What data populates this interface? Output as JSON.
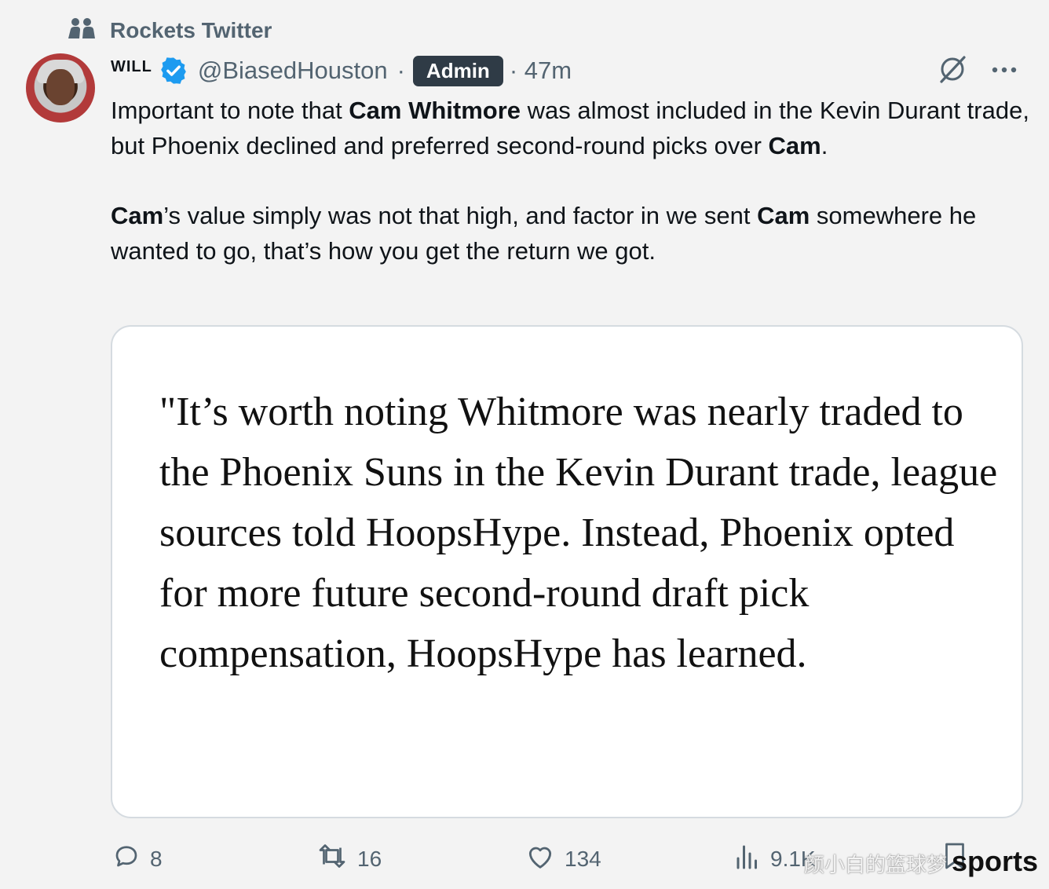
{
  "community": {
    "name": "Rockets Twitter"
  },
  "post": {
    "display_name": "WILL",
    "handle": "@BiasedHouston",
    "separator": "·",
    "badge": "Admin",
    "time": "· 47m",
    "paragraph1": {
      "t1": "Important to note that ",
      "b1": "Cam Whitmore",
      "t2": " was almost included in the Kevin Durant trade, but Phoenix declined and preferred second-round picks over ",
      "b2": "Cam",
      "t3": "."
    },
    "paragraph2": {
      "b1": "Cam",
      "t1": "’s value simply was not that high, and factor in we sent ",
      "b2": "Cam",
      "t2": " somewhere he wanted to go, that’s how you get the return we got."
    },
    "quote": "\"It’s worth noting Whitmore was nearly traded to the Phoenix Suns in the Kevin Durant trade, league sources told HoopsHype. Instead, Phoenix opted for more future second-round draft pick compensation, HoopsHype has learned."
  },
  "actions": {
    "replies": "8",
    "reposts": "16",
    "likes": "134",
    "views": "9.1K"
  },
  "watermark": {
    "cn": "颜小白的篮球梦",
    "brand": "sports"
  },
  "colors": {
    "verified": "#1d9bf0",
    "badge_bg": "#2f3b46",
    "muted": "#536471"
  }
}
